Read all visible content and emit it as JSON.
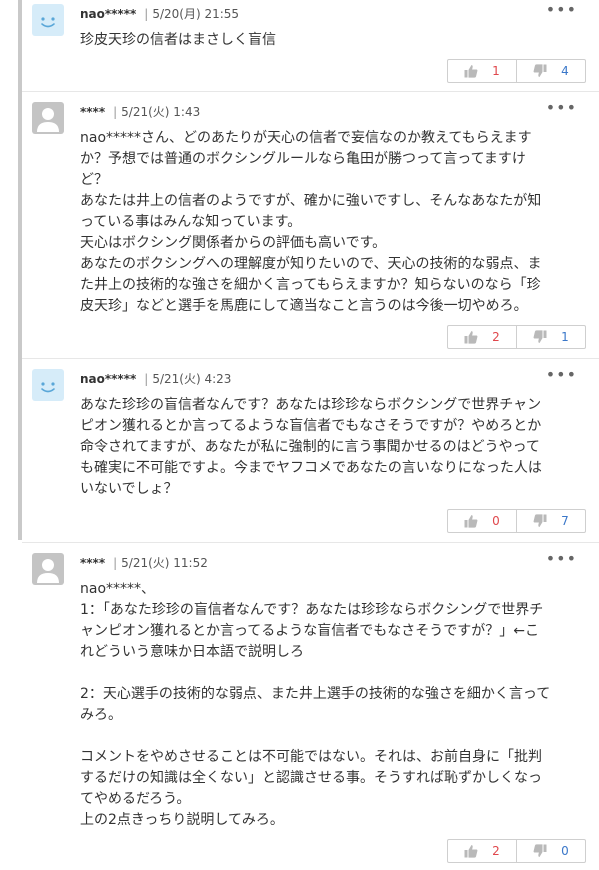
{
  "comments": [
    {
      "user": "nao*****",
      "datetime": "5/20(月) 21:55",
      "avatar": "smile-avatar",
      "text": "珍皮天珍の信者はまさしく盲信",
      "likes": "1",
      "dislikes": "4"
    },
    {
      "user": "****",
      "datetime": "5/21(火) 1:43",
      "avatar": "person-avatar",
      "text": "nao*****さん、どのあたりが天心の信者で妄信なのか教えてもらえます\nか？予想では普通のボクシングルールなら亀田が勝つって言ってますけ\nど？\nあなたは井上の信者のようですが、確かに強いですし、そんなあなたが知\nっている事はみんな知っています。\n天心はボクシング関係者からの評価も高いです。\nあなたのボクシングへの理解度が知りたいので、天心の技術的な弱点、ま\nた井上の技術的な強さを細かく言ってもらえますか？知らないのなら「珍\n皮天珍」などと選手を馬鹿にして適当なこと言うのは今後一切やめろ。",
      "likes": "2",
      "dislikes": "1"
    },
    {
      "user": "nao*****",
      "datetime": "5/21(火) 4:23",
      "avatar": "smile-avatar",
      "text": "あなた珍珍の盲信者なんです？あなたは珍珍ならボクシングで世界チャン\nピオン獲れるとか言ってるような盲信者でもなさそうですが？やめろとか\n命令されてますが、あなたが私に強制的に言う事聞かせるのはどうやって\nも確実に不可能ですよ。今までヤフコメであなたの言いなりになった人は\nいないでしょ？",
      "likes": "0",
      "dislikes": "7"
    },
    {
      "user": "****",
      "datetime": "5/21(火) 11:52",
      "avatar": "person-avatar",
      "text": "nao*****、\n1：「あなた珍珍の盲信者なんです？あなたは珍珍ならボクシングで世界チ\nャンピオン獲れるとか言ってるような盲信者でもなさそうですが？」←こ\nれどういう意味か日本語で説明しろ\n\n2：天心選手の技術的な弱点、また井上選手の技術的な強さを細かく言って\nみろ。\n\nコメントをやめさせることは不可能ではない。それは、お前自身に「批判\nするだけの知識は全くない」と認識させる事。そうすれば恥ずかしくなっ\nてやめるだろう。\n上の2点きっちり説明してみろ。",
      "likes": "2",
      "dislikes": "0"
    }
  ],
  "ui": {
    "separator": "|",
    "more_glyph": "•••",
    "icons": {
      "like": "thumbs-up-icon",
      "dislike": "thumbs-down-icon",
      "more": "more-dots-icon"
    },
    "colors": {
      "like": "#e0474c",
      "dislike": "#3a77c9",
      "avatar_blue": "#d6ecf9",
      "avatar_gray": "#c4c4c4"
    }
  }
}
